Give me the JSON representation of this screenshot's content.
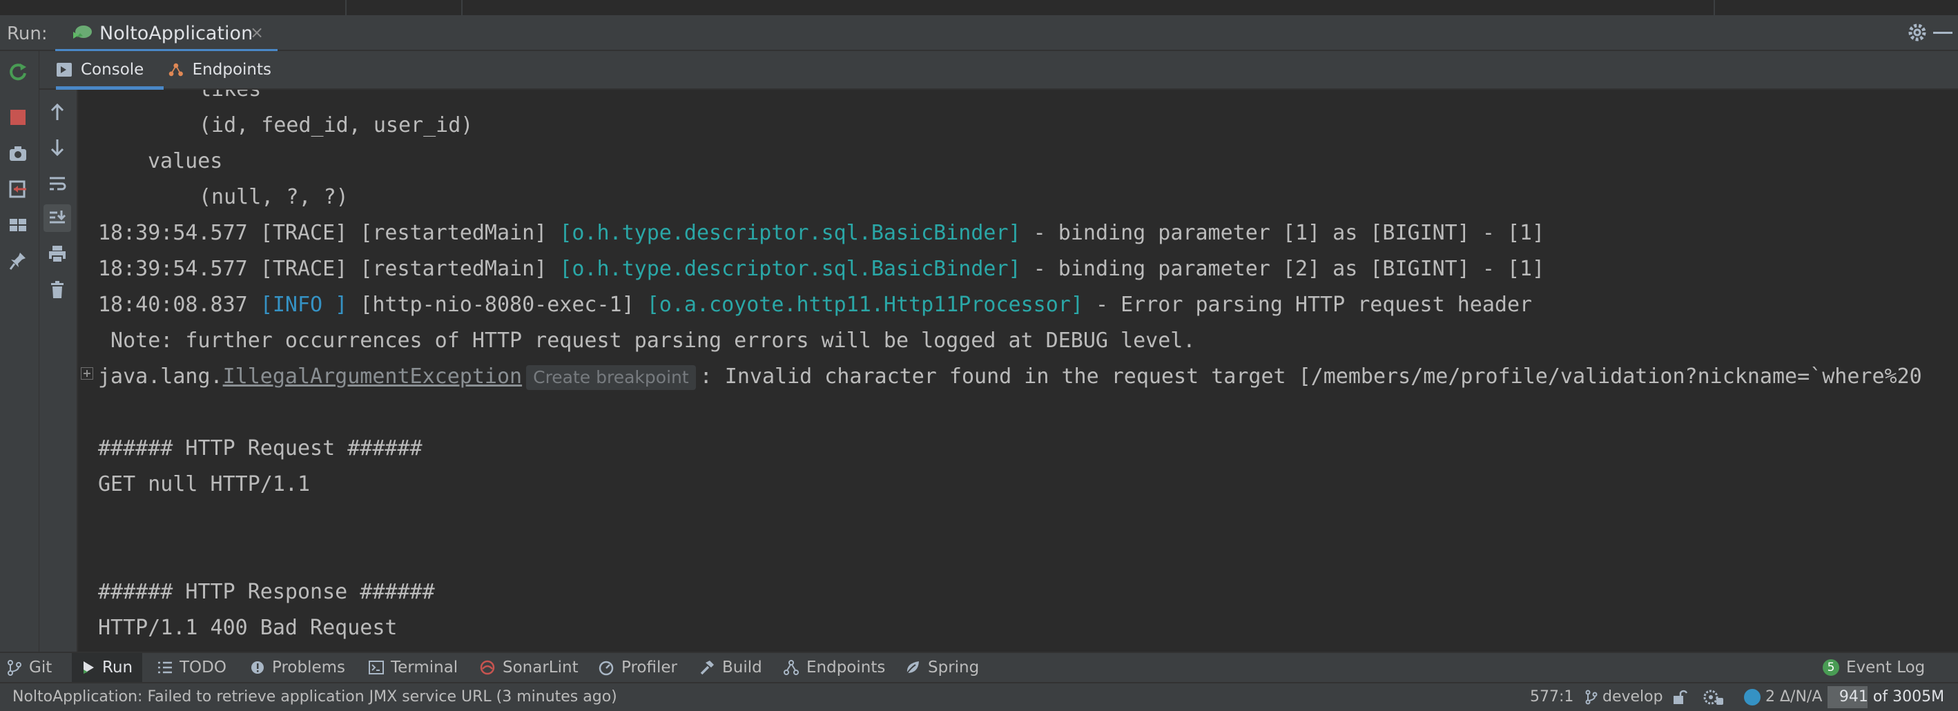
{
  "run_panel": {
    "label": "Run:",
    "tab_name": "NoltoApplication",
    "tab_close": "×"
  },
  "console_tabs": [
    {
      "label": "Console",
      "icon": "terminal-prompt-icon",
      "selected": true
    },
    {
      "label": "Endpoints",
      "icon": "endpoints-icon",
      "selected": false
    }
  ],
  "console": {
    "sql_top": "likes",
    "sql_cols": "(id, feed_id, user_id)",
    "sql_values_kw": "values",
    "sql_values": "(null, ?, ?)",
    "log1": {
      "time": "18:39:54.577",
      "level": "[TRACE]",
      "thread": "[restartedMain]",
      "logger": "[o.h.type.descriptor.sql.BasicBinder]",
      "msg": " - binding parameter [1] as [BIGINT] - [1]"
    },
    "log2": {
      "time": "18:39:54.577",
      "level": "[TRACE]",
      "thread": "[restartedMain]",
      "logger": "[o.h.type.descriptor.sql.BasicBinder]",
      "msg": " - binding parameter [2] as [BIGINT] - [1]"
    },
    "log3": {
      "time": "18:40:08.837",
      "level": "[INFO ]",
      "thread": "[http-nio-8080-exec-1]",
      "logger": "[o.a.coyote.http11.Http11Processor]",
      "msg": " - Error parsing HTTP request header"
    },
    "note": " Note: further occurrences of HTTP request parsing errors will be logged at DEBUG level.",
    "exc_prefix": "java.lang.",
    "exc_class": "IllegalArgumentException",
    "exc_badge": "Create breakpoint",
    "exc_msg": ": Invalid character found in the request target [/members/me/profile/validation?nickname=`where%20",
    "req_header": "###### HTTP Request ######",
    "req_line": "GET null HTTP/1.1",
    "resp_header": "###### HTTP Response ######",
    "resp_line": "HTTP/1.1 400 Bad Request"
  },
  "tool_windows": [
    {
      "label": "Git",
      "icon": "git-branch-icon"
    },
    {
      "label": "Run",
      "icon": "run-play-icon",
      "active": true
    },
    {
      "label": "TODO",
      "icon": "list-icon"
    },
    {
      "label": "Problems",
      "icon": "problems-icon"
    },
    {
      "label": "Terminal",
      "icon": "terminal-icon"
    },
    {
      "label": "SonarLint",
      "icon": "sonarlint-icon"
    },
    {
      "label": "Profiler",
      "icon": "profiler-icon"
    },
    {
      "label": "Build",
      "icon": "hammer-icon"
    },
    {
      "label": "Endpoints",
      "icon": "endpoints-icon"
    },
    {
      "label": "Spring",
      "icon": "spring-leaf-icon"
    }
  ],
  "event_log": {
    "badge": "5",
    "label": "Event Log"
  },
  "status_bar": {
    "message": "NoltoApplication: Failed to retrieve application JMX service URL (3 minutes ago)",
    "position": "577:1",
    "branch": "develop",
    "cs_status": "2 Δ/N/A",
    "memory": "941 of 3005M",
    "memory_used_fraction": 0.313
  },
  "colors": {
    "accent_blue": "#4a88c7",
    "logger_cyan": "#2aa7a7",
    "info_blue": "#3592c4",
    "stop_red": "#c75450",
    "run_green": "#499c54"
  }
}
